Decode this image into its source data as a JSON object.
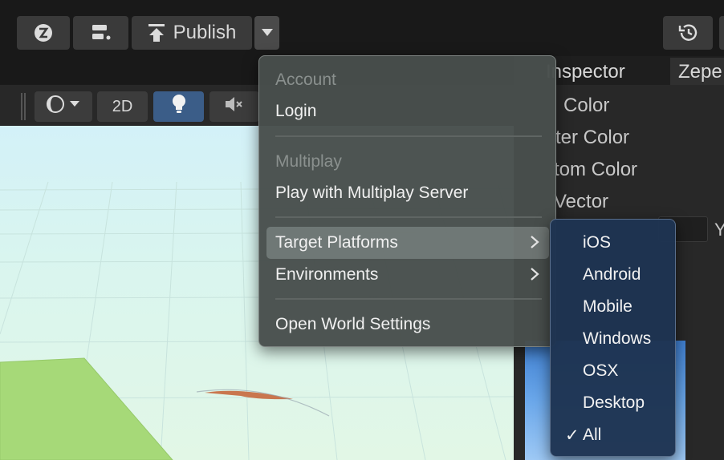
{
  "toolbar": {
    "publish_label": "Publish"
  },
  "scene_toolbar": {
    "mode_2d_label": "2D"
  },
  "inspector": {
    "tabs": [
      {
        "label": "Inspector"
      },
      {
        "label": "Zepe"
      }
    ],
    "properties": [
      {
        "label": "Color"
      },
      {
        "label": "ter Color"
      },
      {
        "label": "tom Color"
      },
      {
        "label": "Vector"
      }
    ],
    "vector_y_label": "Y"
  },
  "menu": {
    "account_header": "Account",
    "login": "Login",
    "multiplay_header": "Multiplay",
    "play_multiplay": "Play with Multiplay Server",
    "target_platforms": "Target Platforms",
    "environments": "Environments",
    "open_world_settings": "Open World Settings"
  },
  "submenu": {
    "items": [
      {
        "label": "iOS",
        "checked": false
      },
      {
        "label": "Android",
        "checked": false
      },
      {
        "label": "Mobile",
        "checked": false
      },
      {
        "label": "Windows",
        "checked": false
      },
      {
        "label": "OSX",
        "checked": false
      },
      {
        "label": "Desktop",
        "checked": false
      },
      {
        "label": "All",
        "checked": true
      }
    ],
    "check_mark": "✓"
  }
}
